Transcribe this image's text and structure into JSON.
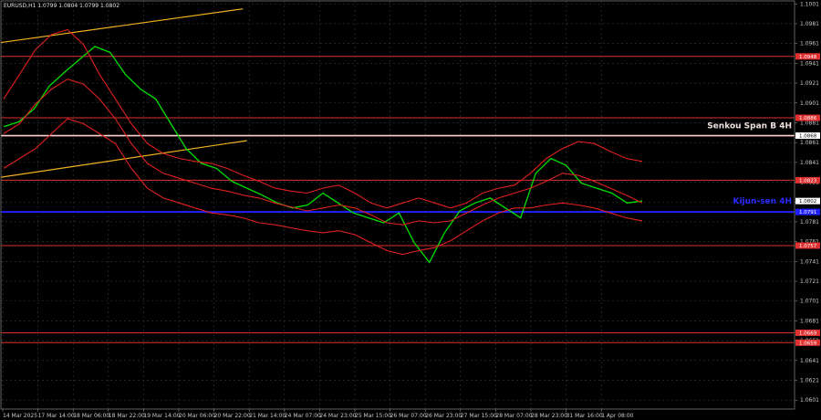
{
  "chart_data": {
    "type": "line",
    "title": "EURUSD,H1  1.0799 1.0804 1.0799 1.0802",
    "ylim": [
      1.0592,
      1.1004
    ],
    "x_labels": [
      "14 Mar 2025",
      "17 Mar 14:00",
      "18 Mar 06:00",
      "18 Mar 22:00",
      "19 Mar 14:00",
      "20 Mar 06:00",
      "20 Mar 22:00",
      "21 Mar 14:00",
      "24 Mar 07:00",
      "24 Mar 23:00",
      "25 Mar 15:00",
      "26 Mar 07:00",
      "26 Mar 23:00",
      "27 Mar 15:00",
      "28 Mar 07:00",
      "28 Mar 23:00",
      "31 Mar 16:00",
      "1 Apr 08:00"
    ],
    "y_ticks": [
      "1.1001",
      "1.0981",
      "1.0961",
      "1.0941",
      "1.0921",
      "1.0901",
      "1.0881",
      "1.0861",
      "1.0841",
      "1.0821",
      "1.0801",
      "1.0781",
      "1.0761",
      "1.0741",
      "1.0721",
      "1.0701",
      "1.0681",
      "1.0661",
      "1.0641",
      "1.0621",
      "1.0601"
    ],
    "price_levels": [
      {
        "label": "1.0948",
        "price": 1.0948,
        "color": "#e03030"
      },
      {
        "label": "1.0886",
        "price": 1.0886,
        "color": "#e03030"
      },
      {
        "label": "1.0868",
        "price": 1.0868,
        "color": "#ffd0d0",
        "name": "Senkou Span B 4H"
      },
      {
        "label": "1.0823",
        "price": 1.0823,
        "color": "#e03030"
      },
      {
        "label": "1.0791",
        "price": 1.0791,
        "color": "#2020ff",
        "name": "Kijun-sen 4H"
      },
      {
        "label": "1.0757",
        "price": 1.0757,
        "color": "#e03030"
      },
      {
        "label": "1.0669",
        "price": 1.0669,
        "color": "#e03030"
      },
      {
        "label": "1.0659",
        "price": 1.0659,
        "color": "#e03030"
      }
    ],
    "current_price": "1.0802",
    "series": [
      {
        "name": "",
        "color": "#00e000",
        "values": [
          1.0877,
          1.0882,
          1.0895,
          1.0918,
          1.0932,
          1.0945,
          1.0958,
          1.0952,
          1.093,
          1.0915,
          1.0905,
          1.088,
          1.0855,
          1.084,
          1.0835,
          1.0822,
          1.0815,
          1.0808,
          1.08,
          1.0795,
          1.0798,
          1.081,
          1.08,
          1.079,
          1.0785,
          1.078,
          1.079,
          1.076,
          1.074,
          1.077,
          1.0792,
          1.08,
          1.0805,
          1.0795,
          1.0785,
          1.083,
          1.0845,
          1.0838,
          1.082,
          1.0815,
          1.081,
          1.08,
          1.0802
        ]
      },
      {
        "name": "",
        "color": "#e02020",
        "values": [
          1.0905,
          1.093,
          1.0955,
          1.097,
          1.0975,
          1.096,
          1.093,
          1.0905,
          1.088,
          1.086,
          1.085,
          1.0845,
          1.0842,
          1.084,
          1.0835,
          1.0828,
          1.0822,
          1.0815,
          1.0812,
          1.081,
          1.0815,
          1.0818,
          1.081,
          1.08,
          1.0795,
          1.08,
          1.0805,
          1.08,
          1.0795,
          1.08,
          1.081,
          1.0815,
          1.0818,
          1.083,
          1.0845,
          1.0855,
          1.0862,
          1.086,
          1.0852,
          1.0845,
          1.0842
        ]
      },
      {
        "name": "",
        "color": "#e02020",
        "values": [
          1.087,
          1.088,
          1.09,
          1.0915,
          1.0925,
          1.092,
          1.0905,
          1.0885,
          1.086,
          1.084,
          1.083,
          1.0825,
          1.082,
          1.0815,
          1.0812,
          1.0808,
          1.0805,
          1.08,
          1.0796,
          1.0792,
          1.0795,
          1.0798,
          1.0795,
          1.0788,
          1.078,
          1.0778,
          1.0782,
          1.078,
          1.0782,
          1.079,
          1.0798,
          1.0805,
          1.081,
          1.0815,
          1.0822,
          1.083,
          1.0828,
          1.0822,
          1.0815,
          1.0808,
          1.08
        ]
      },
      {
        "name": "",
        "color": "#e02020",
        "values": [
          1.0835,
          1.0845,
          1.0855,
          1.087,
          1.0885,
          1.088,
          1.087,
          1.086,
          1.0835,
          1.0815,
          1.0805,
          1.08,
          1.0795,
          1.079,
          1.0788,
          1.0785,
          1.078,
          1.0778,
          1.0775,
          1.0772,
          1.077,
          1.0772,
          1.0768,
          1.076,
          1.0752,
          1.0748,
          1.0752,
          1.0755,
          1.0762,
          1.0772,
          1.0782,
          1.079,
          1.0795,
          1.0795,
          1.0798,
          1.08,
          1.0798,
          1.0795,
          1.079,
          1.0785,
          1.0782
        ]
      }
    ],
    "trend_lines": [
      {
        "color": "#f0b020",
        "from": [
          1.0962,
          0
        ],
        "to": [
          1.0996,
          0.305
        ]
      },
      {
        "color": "#f0b020",
        "from": [
          1.0826,
          0
        ],
        "to": [
          1.0863,
          0.31
        ]
      }
    ],
    "grid": true
  }
}
